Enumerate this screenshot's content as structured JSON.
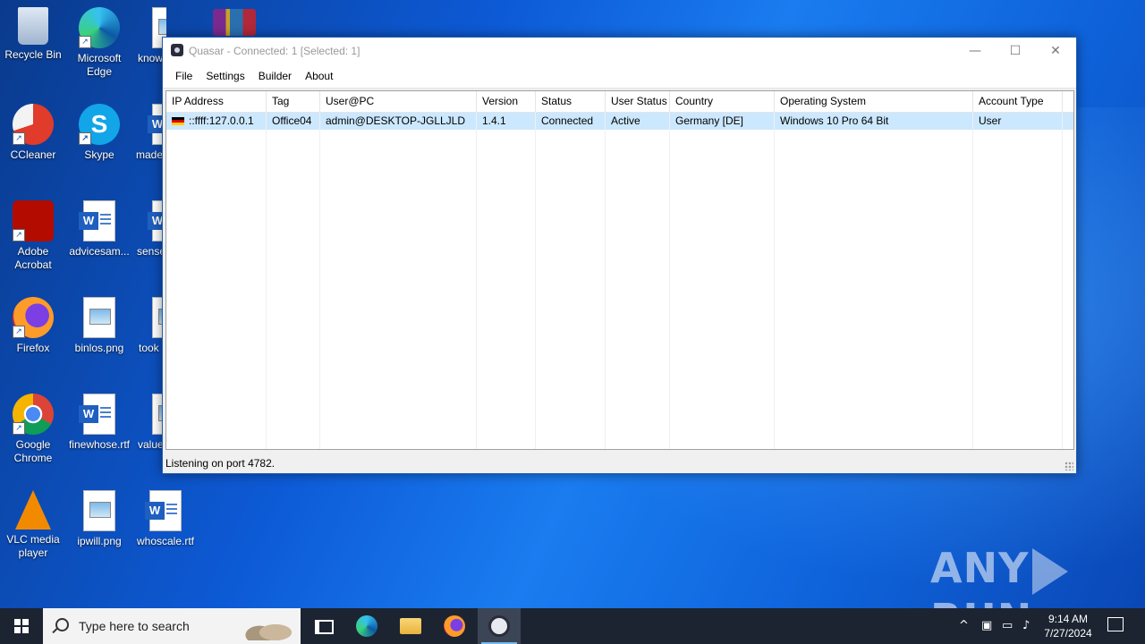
{
  "desktop": {
    "icons": [
      {
        "label": "Recycle Bin"
      },
      {
        "label": "Microsoft Edge"
      },
      {
        "label": "know"
      },
      {
        "label": "CCleaner"
      },
      {
        "label": "Skype"
      },
      {
        "label": "made"
      },
      {
        "label": "Adobe Acrobat"
      },
      {
        "label": "advicesam..."
      },
      {
        "label": "sense"
      },
      {
        "label": "Firefox"
      },
      {
        "label": "binlos.png"
      },
      {
        "label": "took"
      },
      {
        "label": "Google Chrome"
      },
      {
        "label": "finewhose.rtf"
      },
      {
        "label": "value"
      },
      {
        "label": "VLC media player"
      },
      {
        "label": "ipwill.png"
      },
      {
        "label": "whoscale.rtf"
      }
    ]
  },
  "window": {
    "title": "Quasar - Connected: 1 [Selected: 1]",
    "controls": {
      "minimize": "—",
      "maximize": "☐",
      "close": "✕"
    },
    "menu": [
      "File",
      "Settings",
      "Builder",
      "About"
    ],
    "columns": [
      "IP Address",
      "Tag",
      "User@PC",
      "Version",
      "Status",
      "User Status",
      "Country",
      "Operating System",
      "Account Type"
    ],
    "rows": [
      [
        "::ffff:127.0.0.1",
        "Office04",
        "admin@DESKTOP-JGLLJLD",
        "1.4.1",
        "Connected",
        "Active",
        "Germany [DE]",
        "Windows 10 Pro 64 Bit",
        "User"
      ]
    ],
    "status": "Listening on port 4782."
  },
  "watermark": {
    "left": "ANY",
    "right": "RUN"
  },
  "taskbar": {
    "search_placeholder": "Type here to search",
    "time": "9:14 AM",
    "date": "7/27/2024"
  }
}
